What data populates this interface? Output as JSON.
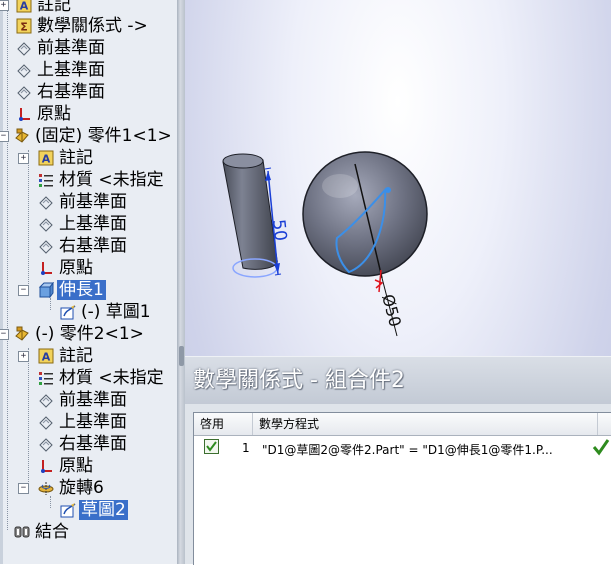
{
  "tree": {
    "items": [
      {
        "label": "註記",
        "icon": "annotation-icon"
      },
      {
        "label": "數學關係式 ->",
        "icon": "equations-icon"
      },
      {
        "label": "前基準面",
        "icon": "plane-icon"
      },
      {
        "label": "上基準面",
        "icon": "plane-icon"
      },
      {
        "label": "右基準面",
        "icon": "plane-icon"
      },
      {
        "label": "原點",
        "icon": "origin-icon"
      },
      {
        "label": "(固定) 零件1<1>",
        "icon": "part-icon"
      },
      {
        "label": "註記",
        "icon": "annotation-icon"
      },
      {
        "label": "材質 <未指定",
        "icon": "material-icon"
      },
      {
        "label": "前基準面",
        "icon": "plane-icon"
      },
      {
        "label": "上基準面",
        "icon": "plane-icon"
      },
      {
        "label": "右基準面",
        "icon": "plane-icon"
      },
      {
        "label": "原點",
        "icon": "origin-icon"
      },
      {
        "label": "伸長1",
        "icon": "extrude-icon"
      },
      {
        "label": "(-) 草圖1",
        "icon": "sketch-icon"
      },
      {
        "label": "(-) 零件2<1>",
        "icon": "part-icon"
      },
      {
        "label": "註記",
        "icon": "annotation-icon"
      },
      {
        "label": "材質 <未指定",
        "icon": "material-icon"
      },
      {
        "label": "前基準面",
        "icon": "plane-icon"
      },
      {
        "label": "上基準面",
        "icon": "plane-icon"
      },
      {
        "label": "右基準面",
        "icon": "plane-icon"
      },
      {
        "label": "原點",
        "icon": "origin-icon"
      },
      {
        "label": "旋轉6",
        "icon": "revolve-icon"
      },
      {
        "label": "草圖2",
        "icon": "sketch-icon"
      },
      {
        "label": "結合",
        "icon": "mates-icon"
      }
    ]
  },
  "viewport": {
    "cylinder_dimension": "50",
    "sphere_dimension": "Ø50"
  },
  "equations_dialog": {
    "title": "數學關係式 - 組合件2",
    "columns": [
      "啓用",
      "數學方程式"
    ],
    "rows": [
      {
        "index": "1",
        "equation": "\"D1@草圖2@零件2.Part\" = \"D1@伸長1@零件1.P...",
        "enabled": true
      }
    ]
  },
  "colors": {
    "selection": "#3a6fc9",
    "dimension_blue": "#1a3fd6",
    "dimension_red": "#e0141e",
    "sketch_blue": "#3b8fe8",
    "check_green": "#2e8b1e"
  }
}
